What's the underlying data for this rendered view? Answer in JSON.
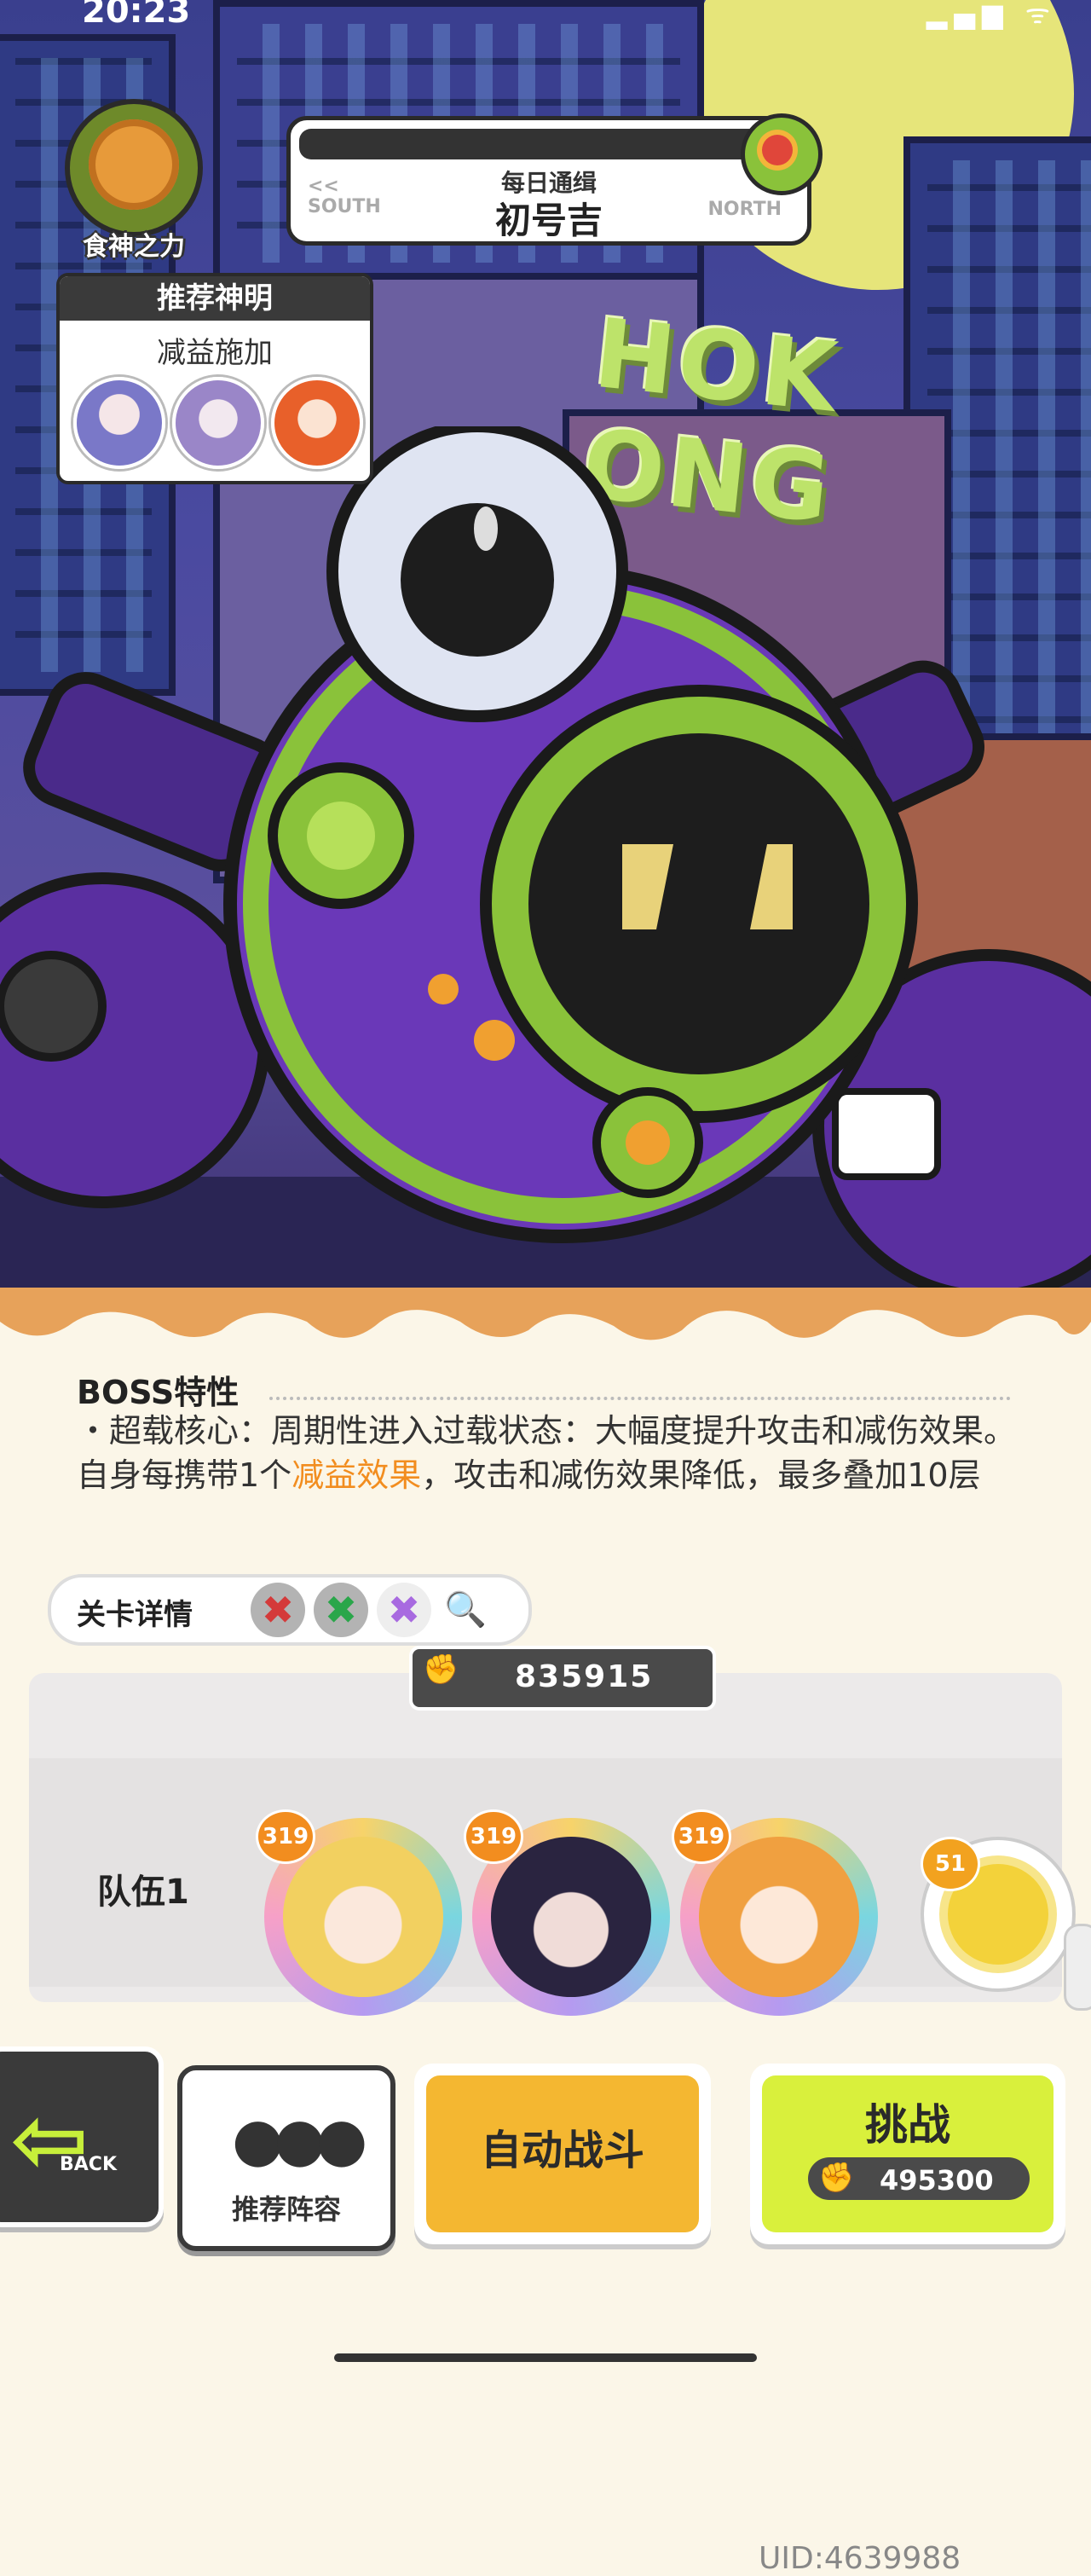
{
  "status_bar": {
    "time": "20:23",
    "icons": "▂▄▆ ᯤ"
  },
  "scene": {
    "sign_text": "HOK ONG"
  },
  "food_power": {
    "label": "食神之力"
  },
  "route_sign": {
    "subtitle": "每日通缉",
    "title": "初号吉",
    "left": "<<\nSOUTH",
    "right": "NORTH"
  },
  "recommended_gods": {
    "header": "推荐神明",
    "tag": "减益施加"
  },
  "boss_traits": {
    "title": "BOSS特性",
    "desc_prefix": "・超载核心：周期性进入过载状态：大幅度提升攻击和减伤效果。自身每携带1个",
    "desc_highlight": "减益效果",
    "desc_suffix": "，攻击和减伤效果降低，最多叠加10层"
  },
  "stage_detail": {
    "label": "关卡详情",
    "search_icon_glyph": "🔍"
  },
  "team": {
    "power": "835915",
    "label": "队伍1",
    "members": [
      {
        "level": "319"
      },
      {
        "level": "319"
      },
      {
        "level": "319"
      }
    ],
    "pet": {
      "level": "51"
    }
  },
  "buttons": {
    "back": "BACK",
    "back_arrow": "⇦",
    "recommend": "推荐阵容",
    "auto": "自动战斗",
    "challenge": "挑战",
    "challenge_cost": "495300"
  },
  "footer": {
    "uid": "UID:4639988"
  },
  "colors": {
    "accent_orange": "#f28d1f",
    "challenge_green": "#d9f03c",
    "auto_yellow": "#f4b731"
  }
}
